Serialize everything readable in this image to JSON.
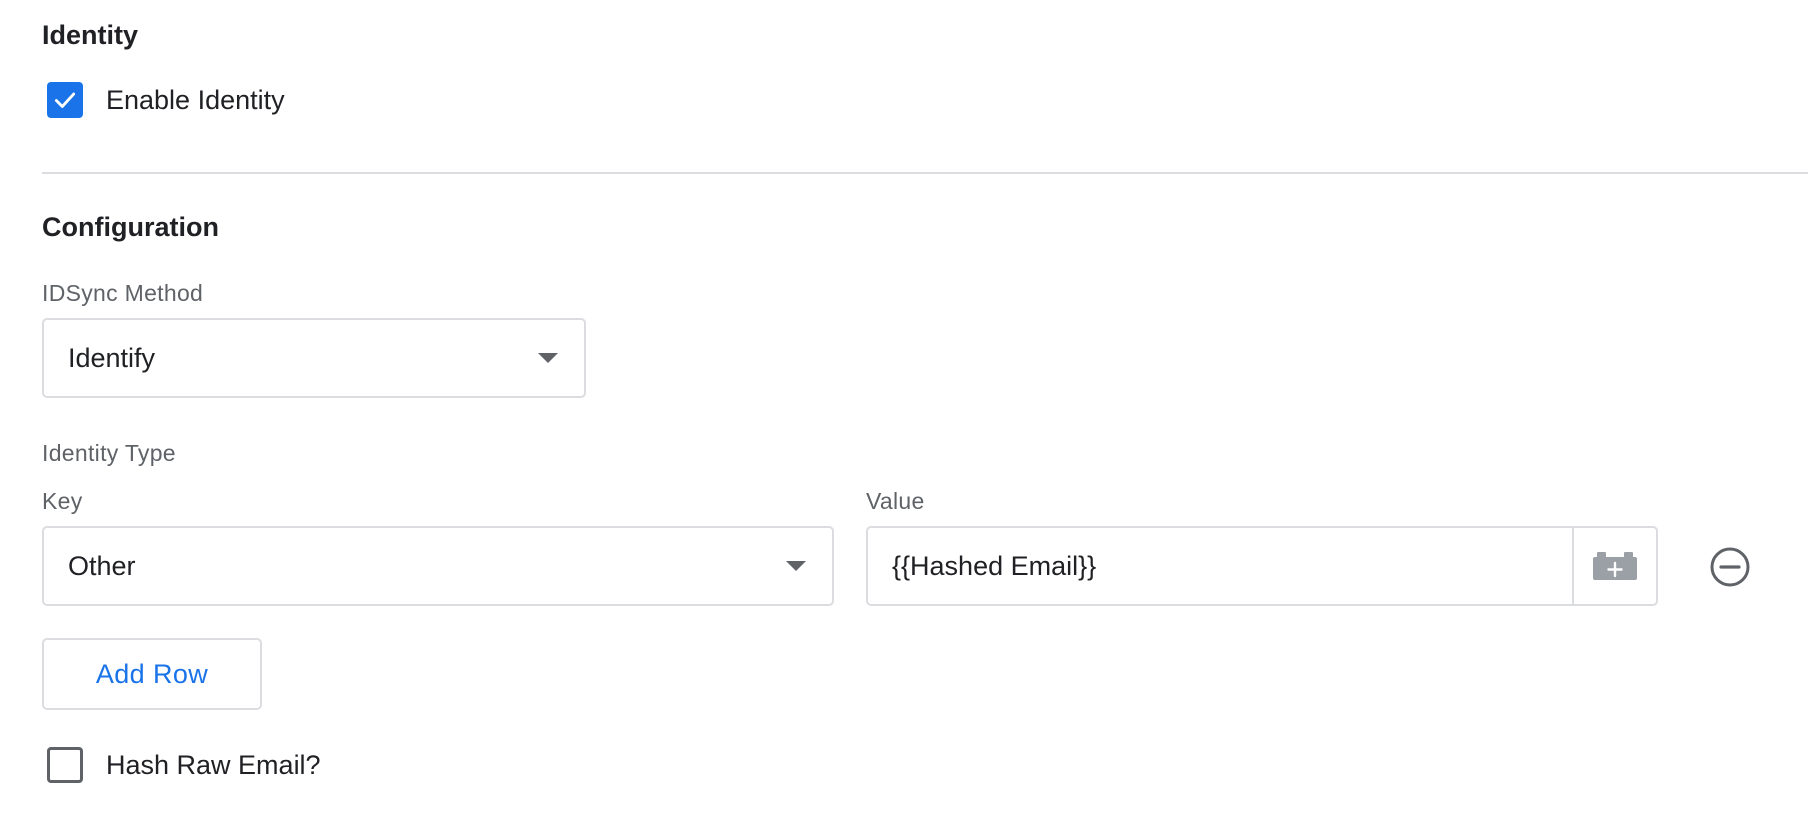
{
  "identity_section": {
    "title": "Identity",
    "enable_checkbox": {
      "label": "Enable Identity",
      "checked": true
    }
  },
  "configuration_section": {
    "title": "Configuration",
    "idsync_method": {
      "label": "IDSync Method",
      "value": "Identify"
    },
    "identity_type": {
      "label": "Identity Type",
      "key_label": "Key",
      "value_label": "Value",
      "rows": [
        {
          "key": "Other",
          "value": "{{Hashed Email}}"
        }
      ]
    },
    "add_row_label": "Add Row",
    "hash_raw_email": {
      "label": "Hash Raw Email?",
      "checked": false
    }
  },
  "icons": {
    "checkmark": "check-icon",
    "dropdown": "caret-down-icon",
    "variable_picker": "lego-brick-plus-icon",
    "remove_row": "minus-circle-icon"
  },
  "colors": {
    "accent": "#1a73e8",
    "text": "#202124",
    "secondary_text": "#5f6368",
    "border": "#dadce0",
    "icon_gray": "#9aa0a6"
  }
}
